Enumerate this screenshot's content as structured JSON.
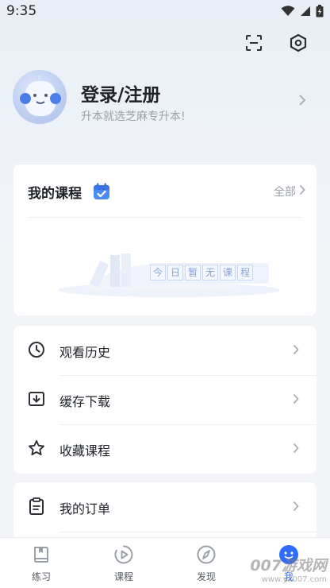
{
  "status_bar": {
    "time": "9:35"
  },
  "profile": {
    "title": "登录/注册",
    "subtitle": "升本就选芝麻专升本!"
  },
  "my_courses": {
    "title": "我的课程",
    "all_label": "全部",
    "empty_chars": [
      "今",
      "日",
      "暂",
      "无",
      "课",
      "程"
    ]
  },
  "menu": [
    {
      "label": "观看历史",
      "icon": "clock-icon"
    },
    {
      "label": "缓存下载",
      "icon": "download-icon"
    },
    {
      "label": "收藏课程",
      "icon": "star-icon"
    }
  ],
  "orders": {
    "label": "我的订单",
    "icon": "clipboard-icon"
  },
  "tabs": [
    {
      "label": "练习",
      "icon": "book-icon"
    },
    {
      "label": "课程",
      "icon": "play-icon"
    },
    {
      "label": "发现",
      "icon": "compass-icon"
    },
    {
      "label": "我",
      "icon": "smiley-icon"
    }
  ],
  "watermark": {
    "big": "007游戏网",
    "small": "www.yx007.com"
  },
  "colors": {
    "accent": "#2f6bff",
    "text": "#1f2329",
    "muted": "#9aa0a8",
    "background": "#f2f4f8"
  }
}
